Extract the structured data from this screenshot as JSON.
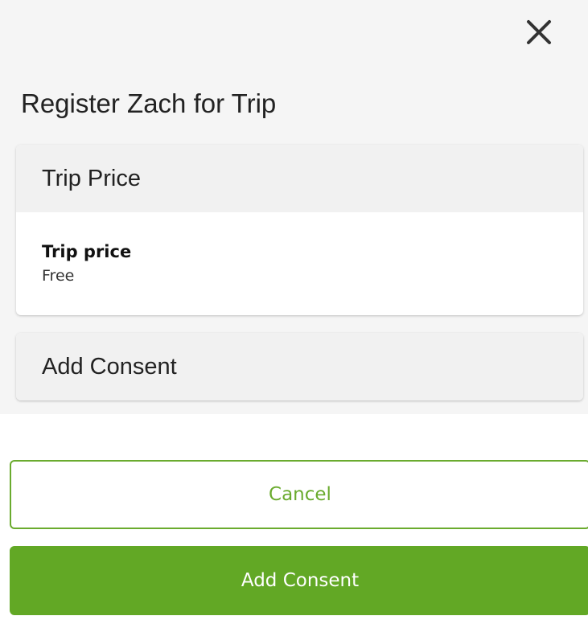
{
  "modal": {
    "title": "Register Zach for Trip",
    "close_icon": "close-icon"
  },
  "trip_price_section": {
    "header": "Trip Price",
    "field_label": "Trip price",
    "field_value": "Free"
  },
  "consent_section": {
    "header": "Add Consent"
  },
  "actions": {
    "cancel_label": "Cancel",
    "primary_label": "Add Consent"
  },
  "colors": {
    "accent": "#62a825",
    "accent_border": "#6aab2e",
    "panel_background": "#f5f5f5",
    "card_header_background": "#f1f1f1"
  }
}
